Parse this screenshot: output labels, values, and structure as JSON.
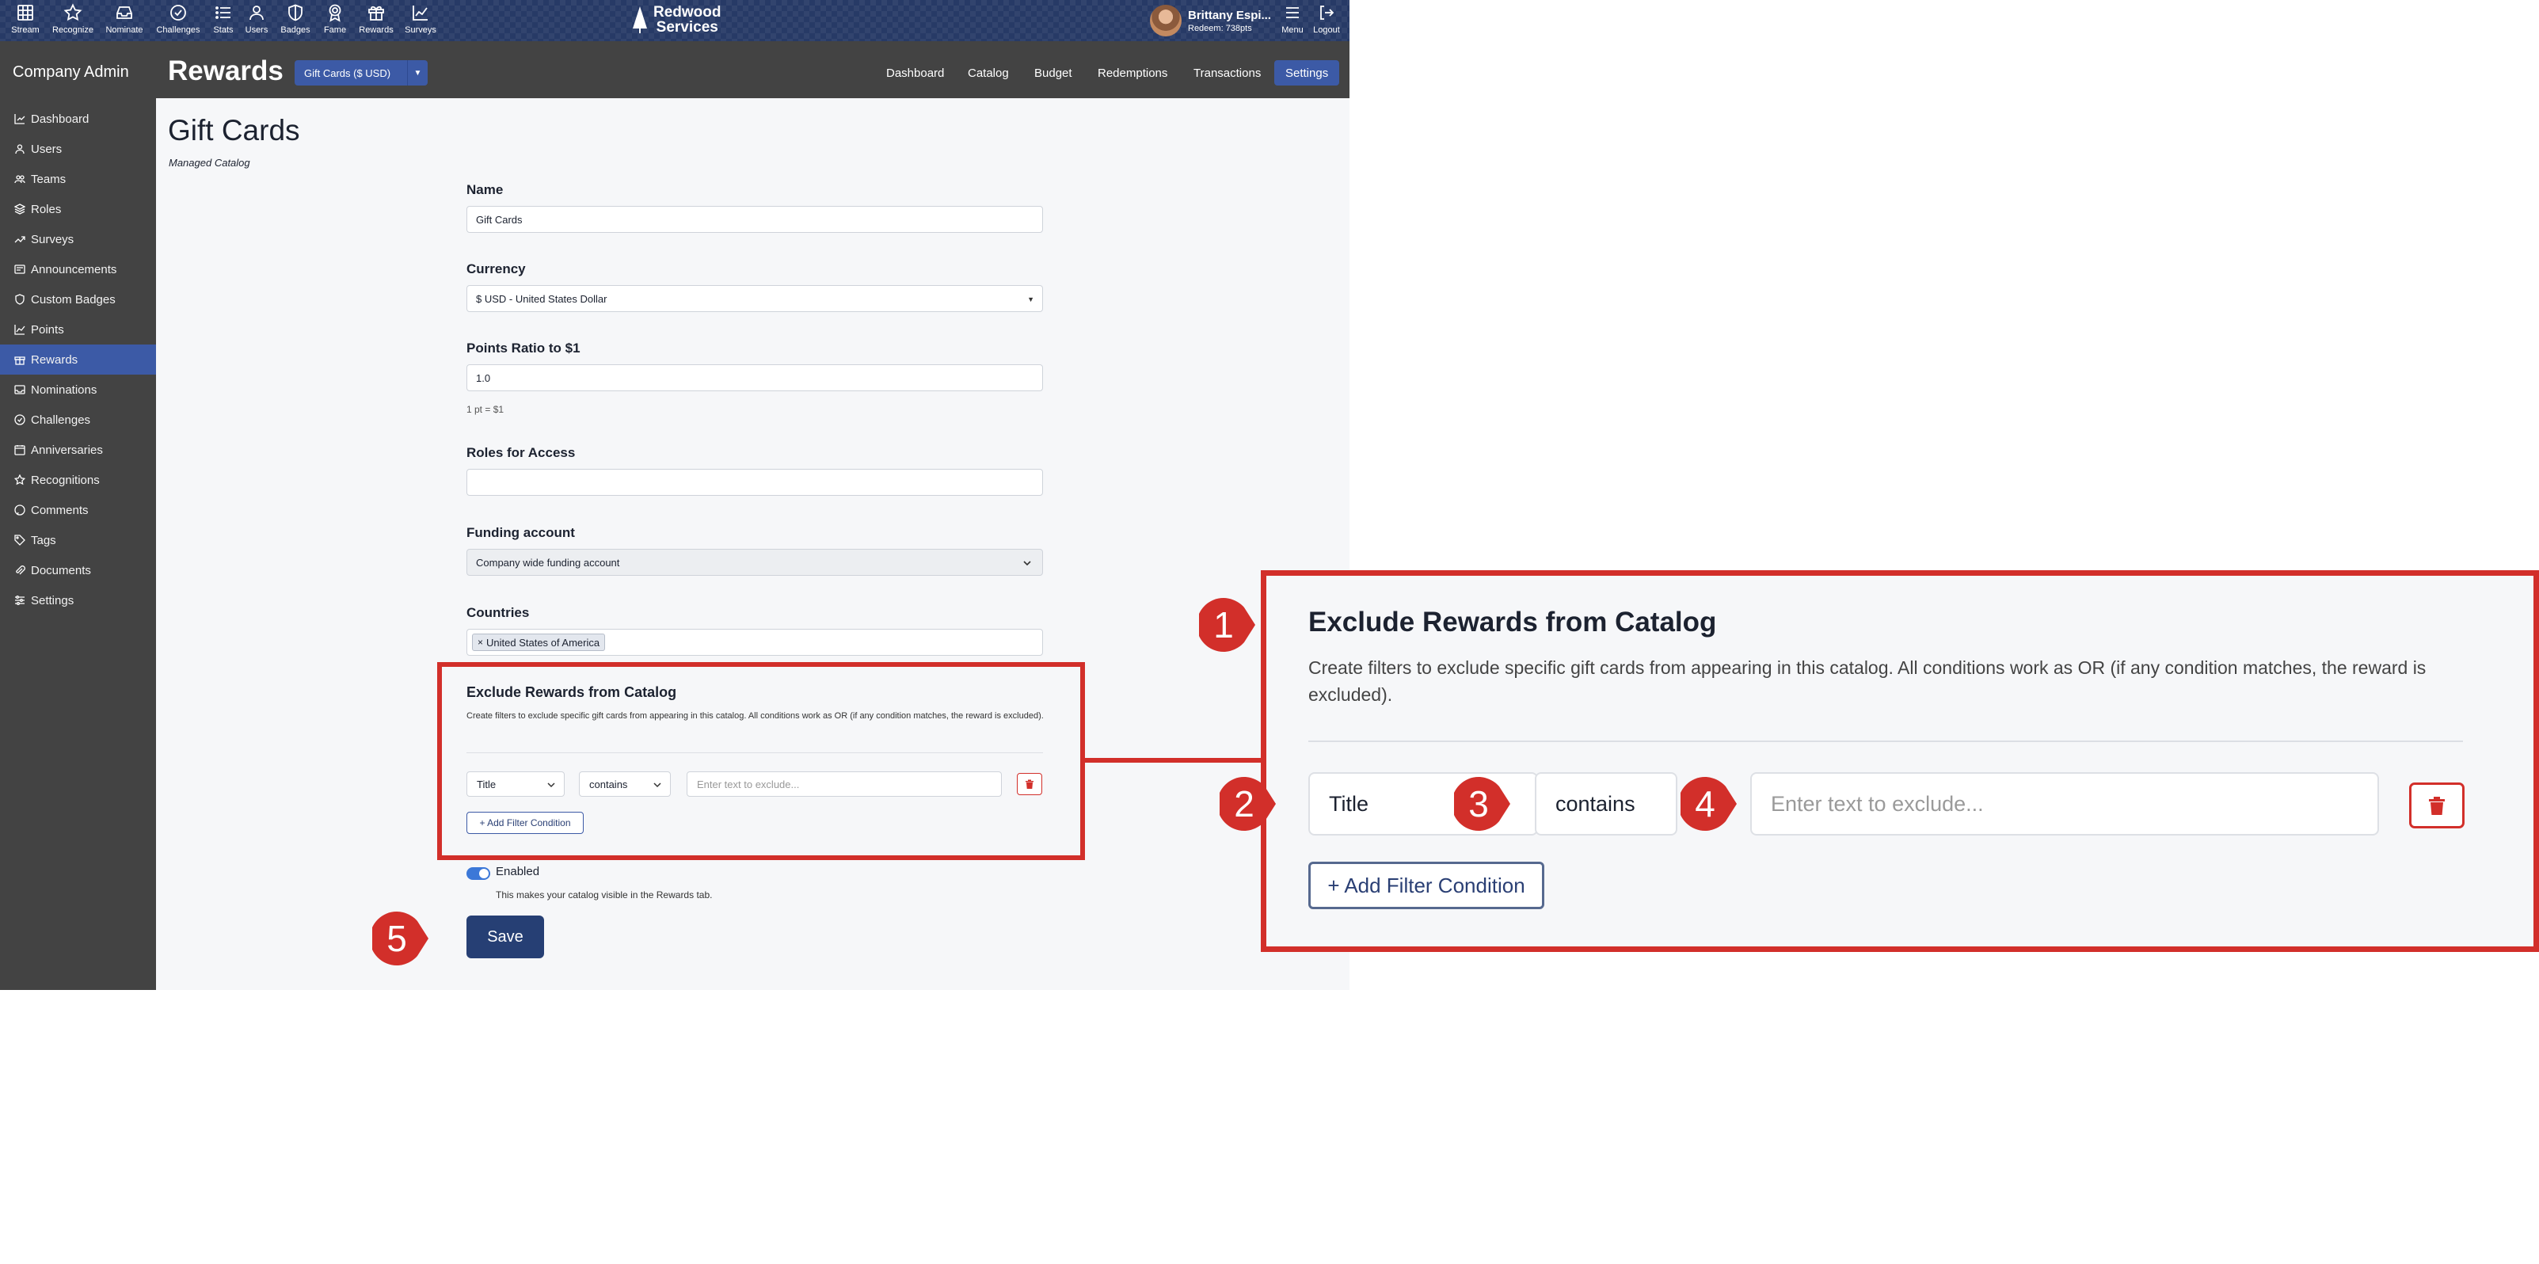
{
  "nav": {
    "items": [
      {
        "label": "Stream",
        "icon": "grid-icon"
      },
      {
        "label": "Recognize",
        "icon": "star-icon"
      },
      {
        "label": "Nominate",
        "icon": "inbox-icon"
      },
      {
        "label": "Challenges",
        "icon": "check-circle-icon"
      },
      {
        "label": "Stats",
        "icon": "list-icon"
      },
      {
        "label": "Users",
        "icon": "user-icon"
      },
      {
        "label": "Badges",
        "icon": "shield-icon"
      },
      {
        "label": "Fame",
        "icon": "award-icon"
      },
      {
        "label": "Rewards",
        "icon": "gift-icon"
      },
      {
        "label": "Surveys",
        "icon": "trend-icon"
      }
    ],
    "brand_line1": "Redwood",
    "brand_line2": "Services",
    "user_name": "Brittany Espi...",
    "user_redeem": "Redeem: 738pts",
    "menu_label": "Menu",
    "logout_label": "Logout"
  },
  "sidebar": {
    "title": "Company Admin",
    "items": [
      {
        "label": "Dashboard"
      },
      {
        "label": "Users"
      },
      {
        "label": "Teams"
      },
      {
        "label": "Roles"
      },
      {
        "label": "Surveys"
      },
      {
        "label": "Announcements"
      },
      {
        "label": "Custom Badges"
      },
      {
        "label": "Points"
      },
      {
        "label": "Rewards"
      },
      {
        "label": "Nominations"
      },
      {
        "label": "Challenges"
      },
      {
        "label": "Anniversaries"
      },
      {
        "label": "Recognitions"
      },
      {
        "label": "Comments"
      },
      {
        "label": "Tags"
      },
      {
        "label": "Documents"
      },
      {
        "label": "Settings"
      }
    ],
    "active": "Rewards"
  },
  "header": {
    "title": "Rewards",
    "catalog_select": "Gift Cards ($ USD)",
    "tabs": [
      "Dashboard",
      "Catalog",
      "Budget",
      "Redemptions",
      "Transactions",
      "Settings"
    ],
    "active_tab": "Settings"
  },
  "form": {
    "heading": "Gift Cards",
    "subtitle": "Managed Catalog",
    "name_label": "Name",
    "name_value": "Gift Cards",
    "currency_label": "Currency",
    "currency_value": "$ USD - United States Dollar",
    "ratio_label": "Points Ratio to $1",
    "ratio_value": "1.0",
    "ratio_hint": "1 pt = $1",
    "roles_label": "Roles for Access",
    "roles_value": "",
    "funding_label": "Funding account",
    "funding_value": "Company wide funding account",
    "countries_label": "Countries",
    "countries_chip": "United States of America",
    "chip_remove": "×",
    "exclude_title": "Exclude Rewards from Catalog",
    "exclude_desc": "Create filters to exclude specific gift cards from appearing in this catalog. All conditions work as OR (if any condition matches, the reward is excluded).",
    "filter_field": "Title",
    "filter_op": "contains",
    "filter_placeholder": "Enter text to exclude...",
    "add_filter": "+ Add Filter Condition",
    "enabled_label": "Enabled",
    "enabled_hint": "This makes your catalog visible in the Rewards tab.",
    "enabled": true,
    "save_label": "Save"
  },
  "callouts": [
    "1",
    "2",
    "3",
    "4",
    "5"
  ],
  "colors": {
    "topbar": "#273a66",
    "sidebar": "#434343",
    "accent": "#3c5aa6",
    "save": "#263f74",
    "callout_red": "#d22f2a"
  }
}
